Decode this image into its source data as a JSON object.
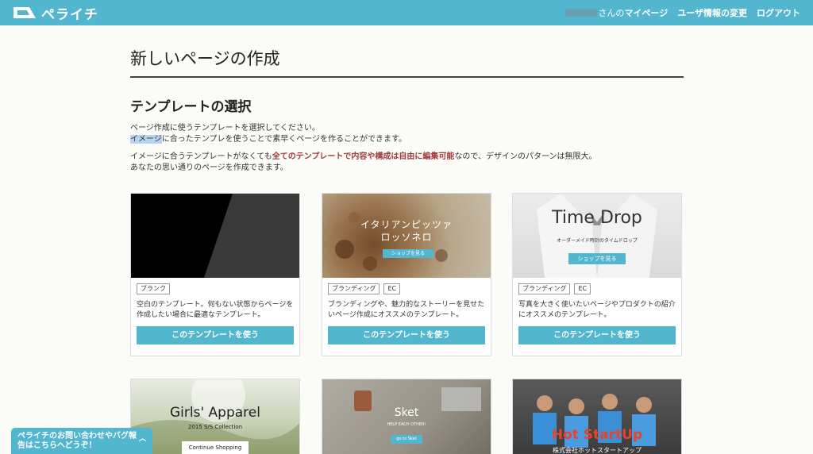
{
  "header": {
    "logo_text": "ペライチ",
    "owner_suffix": "さんの",
    "mypage": "マイページ",
    "user_settings": "ユーザ情報の変更",
    "logout": "ログアウト"
  },
  "page": {
    "title": "新しいページの作成",
    "section_title": "テンプレートの選択",
    "desc_line1": "ページ作成に使うテンプレートを選択してください。",
    "desc_line2_highlight": "イメージ",
    "desc_line2_rest": "に合ったテンプレを使うことで素早くページを作ることができます。",
    "desc2_pre": "イメージに合うテンプレートがなくても",
    "desc2_red": "全てのテンプレートで内容や構成は自由に編集可能",
    "desc2_post": "なので、デザインのパターンは無限大。",
    "desc2_line2": "あなたの思い通りのページを作成できます。"
  },
  "cards": [
    {
      "tags": [
        "ブランク"
      ],
      "description": "空白のテンプレート。何もない状態からページを作成したい場合に最適なテンプレート。",
      "button": "このテンプレートを使う"
    },
    {
      "thumb_title_1": "イタリアンピッツァ",
      "thumb_title_2": "ロッソネロ",
      "thumb_button": "ショップを見る",
      "tags": [
        "ブランディング",
        "EC"
      ],
      "description": "ブランディングや、魅力的なストーリーを見せたいページ作成にオススメのテンプレート。",
      "button": "このテンプレートを使う"
    },
    {
      "thumb_title": "Time Drop",
      "thumb_subtitle": "オーダーメイド時計のタイムドロップ",
      "thumb_button": "ショップを見る",
      "tags": [
        "ブランディング",
        "EC"
      ],
      "description": "写真を大きく使いたいページやプロダクトの紹介にオススメのテンプレート。",
      "button": "このテンプレートを使う"
    },
    {
      "thumb_title": "Girls' Apparel",
      "thumb_subtitle": "2015 S/S Collection",
      "thumb_button": "Continue Shopping"
    },
    {
      "thumb_title": "Sket",
      "thumb_subtitle": "HELP EACH OTHER!",
      "thumb_button": "go to Sket"
    },
    {
      "thumb_title": "Hot StartUp",
      "thumb_subtitle": "株式会社ホットスタートアップ"
    }
  ],
  "help": {
    "line1": "ペライチのお問い合わせやバグ報",
    "line2": "告はこちらへどうぞ！"
  },
  "colors": {
    "accent": "#52b6cf",
    "emphasis": "#a03c3c"
  }
}
